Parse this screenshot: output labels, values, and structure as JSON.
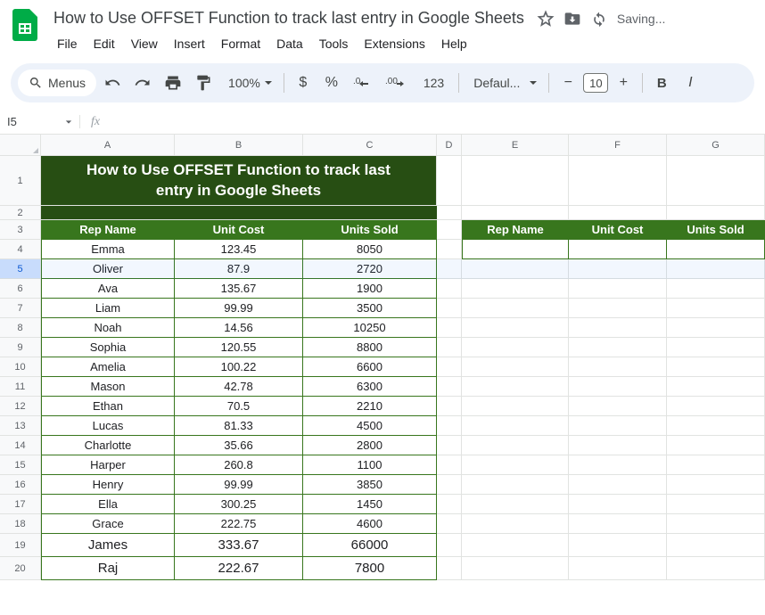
{
  "doc": {
    "title": "How to Use OFFSET Function to track last entry in Google Sheets",
    "save_status": "Saving..."
  },
  "menus": [
    "File",
    "Edit",
    "View",
    "Insert",
    "Format",
    "Data",
    "Tools",
    "Extensions",
    "Help"
  ],
  "toolbar": {
    "menus_label": "Menus",
    "zoom": "100%",
    "currency": "$",
    "percent": "%",
    "auto_decimal": "123",
    "font_name": "Defaul...",
    "minus": "−",
    "font_size": "10",
    "plus": "+",
    "bold": "B",
    "italic": "I"
  },
  "name_box": "I5",
  "columns": [
    "A",
    "B",
    "C",
    "D",
    "E",
    "F",
    "G"
  ],
  "row_numbers": [
    "1",
    "2",
    "3",
    "4",
    "5",
    "6",
    "7",
    "8",
    "9",
    "10",
    "11",
    "12",
    "13",
    "14",
    "15",
    "16",
    "17",
    "18",
    "19",
    "20"
  ],
  "selected_row": 5,
  "sheet_title_line1": "How to Use OFFSET Function to track last",
  "sheet_title_line2": "entry in Google Sheets",
  "headers_main": {
    "rep": "Rep Name",
    "cost": "Unit Cost",
    "sold": "Units Sold"
  },
  "data_rows": [
    {
      "rep": "Emma",
      "cost": "123.45",
      "sold": "8050"
    },
    {
      "rep": "Oliver",
      "cost": "87.9",
      "sold": "2720"
    },
    {
      "rep": "Ava",
      "cost": "135.67",
      "sold": "1900"
    },
    {
      "rep": "Liam",
      "cost": "99.99",
      "sold": "3500"
    },
    {
      "rep": "Noah",
      "cost": "14.56",
      "sold": "10250"
    },
    {
      "rep": "Sophia",
      "cost": "120.55",
      "sold": "8800"
    },
    {
      "rep": "Amelia",
      "cost": "100.22",
      "sold": "6600"
    },
    {
      "rep": "Mason",
      "cost": "42.78",
      "sold": "6300"
    },
    {
      "rep": "Ethan",
      "cost": "70.5",
      "sold": "2210"
    },
    {
      "rep": "Lucas",
      "cost": "81.33",
      "sold": "4500"
    },
    {
      "rep": "Charlotte",
      "cost": "35.66",
      "sold": "2800"
    },
    {
      "rep": "Harper",
      "cost": "260.8",
      "sold": "1100"
    },
    {
      "rep": "Henry",
      "cost": "99.99",
      "sold": "3850"
    },
    {
      "rep": "Ella",
      "cost": "300.25",
      "sold": "1450"
    },
    {
      "rep": "Grace",
      "cost": "222.75",
      "sold": "4600"
    },
    {
      "rep": "James",
      "cost": "333.67",
      "sold": "66000"
    },
    {
      "rep": "Raj",
      "cost": "222.67",
      "sold": "7800"
    }
  ],
  "headers_right": {
    "rep": "Rep Name",
    "cost": "Unit Cost",
    "sold": "Units Sold"
  },
  "right_values": {
    "rep": "",
    "cost": "",
    "sold": ""
  }
}
